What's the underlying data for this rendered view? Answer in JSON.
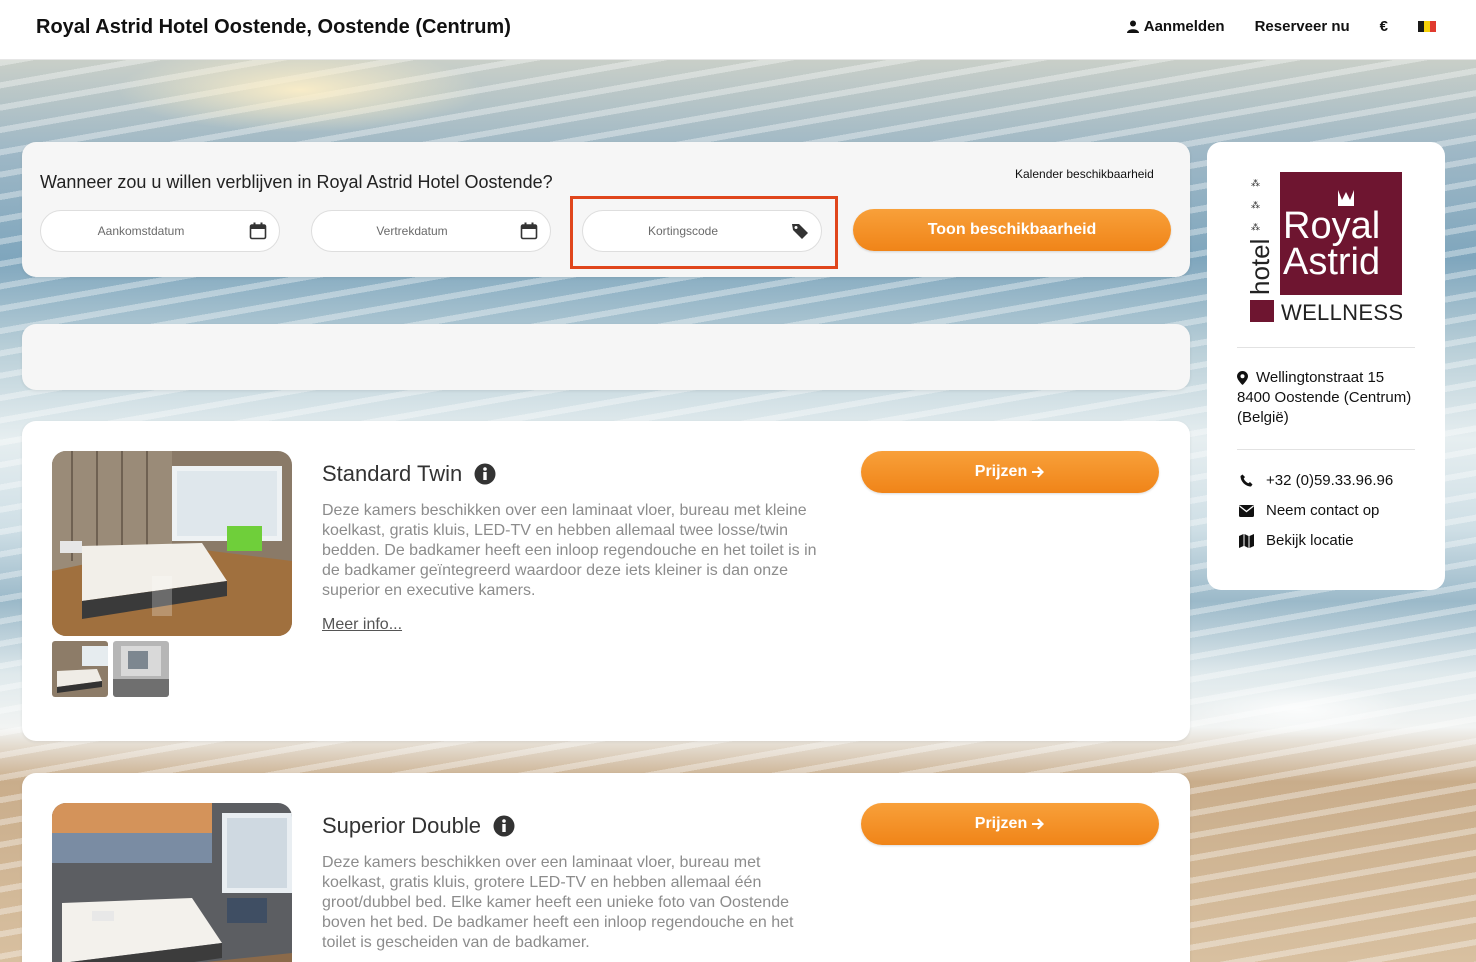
{
  "header": {
    "title": "Royal Astrid Hotel Oostende, Oostende (Centrum)",
    "login": "Aanmelden",
    "book_now": "Reserveer nu",
    "currency": "€",
    "language_flag_colors": [
      "#1a1a1a",
      "#f5d10a",
      "#e03a2e"
    ]
  },
  "search": {
    "question": "Wanneer zou u willen verblijven in Royal Astrid Hotel Oostende?",
    "calendar_link": "Kalender beschikbaarheid",
    "arrival_placeholder": "Aankomstdatum",
    "departure_placeholder": "Vertrekdatum",
    "promo_placeholder": "Kortingscode",
    "show_button": "Toon beschikbaarheid"
  },
  "rooms": [
    {
      "name": "Standard Twin",
      "description": "Deze kamers beschikken over een laminaat vloer, bureau met kleine koelkast, gratis kluis, LED-TV en hebben allemaal twee losse/twin bedden. De badkamer heeft een inloop regendouche en het toilet is in de badkamer geïntegreerd waardoor deze iets kleiner is dan onze superior en executive kamers.",
      "more_info": "Meer info...",
      "prices_button": "Prijzen"
    },
    {
      "name": "Superior Double",
      "description": "Deze kamers beschikken over een laminaat vloer, bureau met koelkast, gratis kluis, grotere LED-TV en hebben allemaal één groot/dubbel bed. Elke kamer heeft een unieke foto van Oostende boven het bed. De badkamer heeft een inloop regendouche en het toilet is gescheiden van de badkamer.",
      "prices_button": "Prijzen"
    }
  ],
  "sidebar": {
    "logo": {
      "word_hotel": "hotel",
      "word_royal": "Royal",
      "word_astrid": "Astrid",
      "word_wellness": "WELLNESS",
      "brand_color": "#6e1530"
    },
    "address_line1": "Wellingtonstraat 15",
    "address_line2": "8400 Oostende (Centrum)",
    "address_line3": "(België)",
    "phone": "+32 (0)59.33.96.96",
    "contact": "Neem contact op",
    "location": "Bekijk locatie"
  },
  "colors": {
    "accent_orange": "#f08418",
    "highlight_red": "#e0461c"
  }
}
